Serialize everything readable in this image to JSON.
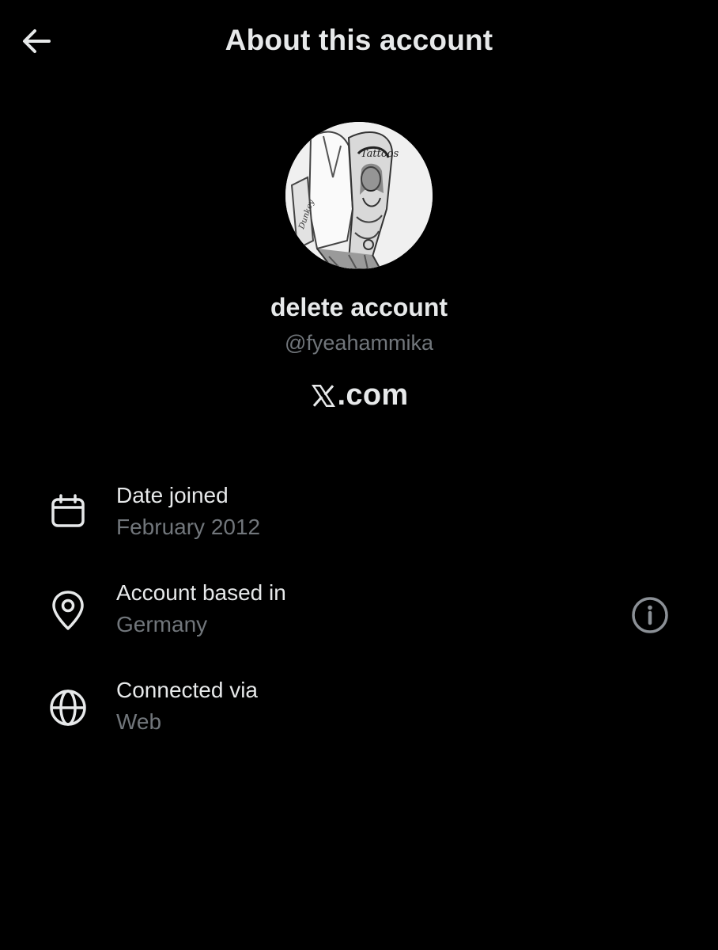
{
  "header": {
    "title": "About this account",
    "back_icon": "arrow-left-icon"
  },
  "profile": {
    "display_name": "delete account",
    "handle": "@fyeahammika",
    "avatar_icon": "profile-avatar-tattoo-illustration"
  },
  "brand": {
    "logo_icon": "x-logo-icon",
    "domain": ".com"
  },
  "details": [
    {
      "icon": "calendar-icon",
      "label": "Date joined",
      "value": "February 2012"
    },
    {
      "icon": "location-pin-icon",
      "label": "Account based in",
      "value": "Germany",
      "action_icon": "info-icon"
    },
    {
      "icon": "globe-icon",
      "label": "Connected via",
      "value": "Web"
    }
  ],
  "colors": {
    "background": "#000000",
    "primary_text": "#e7e9ea",
    "secondary_text": "#71767b"
  }
}
